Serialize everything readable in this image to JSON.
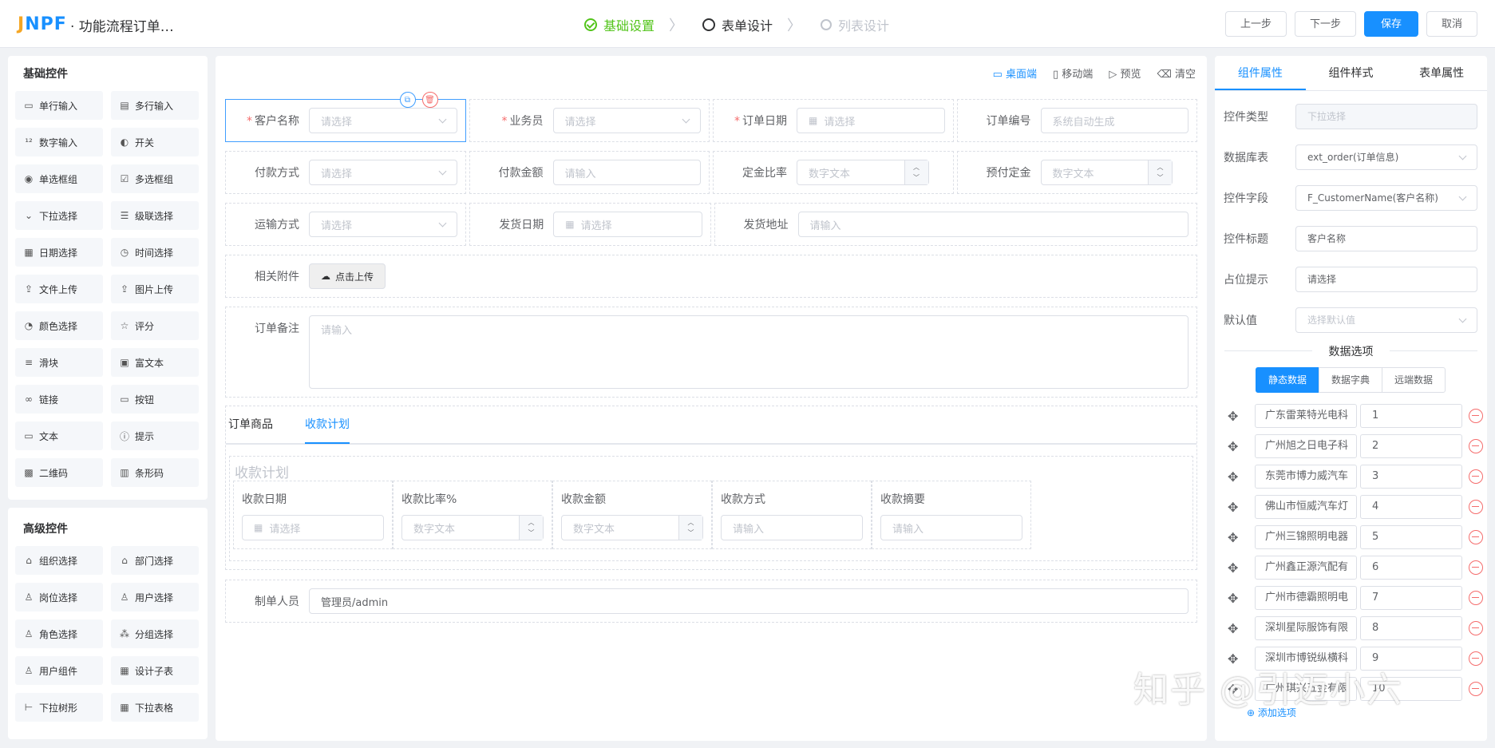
{
  "app": {
    "logo": "JNPF",
    "title": "· 功能流程订单…"
  },
  "steps": [
    {
      "label": "基础设置",
      "state": "done"
    },
    {
      "label": "表单设计",
      "state": "active"
    },
    {
      "label": "列表设计",
      "state": "todo"
    }
  ],
  "top_buttons": {
    "prev": "上一步",
    "next": "下一步",
    "save": "保存",
    "cancel": "取消"
  },
  "basic": {
    "title": "基础控件",
    "items": [
      {
        "label": "单行输入",
        "icon": "input-icon"
      },
      {
        "label": "多行输入",
        "icon": "textarea-icon"
      },
      {
        "label": "数字输入",
        "icon": "number-icon"
      },
      {
        "label": "开关",
        "icon": "switch-icon"
      },
      {
        "label": "单选框组",
        "icon": "radio-icon"
      },
      {
        "label": "多选框组",
        "icon": "checkbox-icon"
      },
      {
        "label": "下拉选择",
        "icon": "select-icon"
      },
      {
        "label": "级联选择",
        "icon": "cascader-icon"
      },
      {
        "label": "日期选择",
        "icon": "calendar-icon"
      },
      {
        "label": "时间选择",
        "icon": "clock-icon"
      },
      {
        "label": "文件上传",
        "icon": "upload-icon"
      },
      {
        "label": "图片上传",
        "icon": "image-upload-icon"
      },
      {
        "label": "颜色选择",
        "icon": "palette-icon"
      },
      {
        "label": "评分",
        "icon": "star-icon"
      },
      {
        "label": "滑块",
        "icon": "slider-icon"
      },
      {
        "label": "富文本",
        "icon": "richtext-icon"
      },
      {
        "label": "链接",
        "icon": "link-icon"
      },
      {
        "label": "按钮",
        "icon": "button-icon"
      },
      {
        "label": "文本",
        "icon": "text-icon"
      },
      {
        "label": "提示",
        "icon": "info-icon"
      },
      {
        "label": "二维码",
        "icon": "qrcode-icon"
      },
      {
        "label": "条形码",
        "icon": "barcode-icon"
      }
    ]
  },
  "advanced": {
    "title": "高级控件",
    "items": [
      {
        "label": "组织选择",
        "icon": "org-icon"
      },
      {
        "label": "部门选择",
        "icon": "dept-icon"
      },
      {
        "label": "岗位选择",
        "icon": "position-icon"
      },
      {
        "label": "用户选择",
        "icon": "user-icon"
      },
      {
        "label": "角色选择",
        "icon": "role-icon"
      },
      {
        "label": "分组选择",
        "icon": "group-icon"
      },
      {
        "label": "用户组件",
        "icon": "user-comp-icon"
      },
      {
        "label": "设计子表",
        "icon": "table-icon"
      },
      {
        "label": "下拉树形",
        "icon": "tree-icon"
      },
      {
        "label": "下拉表格",
        "icon": "table-select-icon"
      }
    ]
  },
  "canvas_toolbar": {
    "desktop": "桌面端",
    "mobile": "移动端",
    "preview": "预览",
    "clear": "清空"
  },
  "form": {
    "row1": [
      {
        "label": "客户名称",
        "required": true,
        "placeholder": "请选择",
        "type": "select"
      },
      {
        "label": "业务员",
        "required": true,
        "placeholder": "请选择",
        "type": "select"
      },
      {
        "label": "订单日期",
        "required": true,
        "placeholder": "请选择",
        "type": "date"
      },
      {
        "label": "订单编号",
        "required": false,
        "placeholder": "系统自动生成",
        "type": "text"
      }
    ],
    "row2": [
      {
        "label": "付款方式",
        "placeholder": "请选择",
        "type": "select"
      },
      {
        "label": "付款金额",
        "placeholder": "请输入",
        "type": "text"
      },
      {
        "label": "定金比率",
        "placeholder": "数字文本",
        "type": "number"
      },
      {
        "label": "预付定金",
        "placeholder": "数字文本",
        "type": "number"
      }
    ],
    "row3": [
      {
        "label": "运输方式",
        "placeholder": "请选择",
        "type": "select"
      },
      {
        "label": "发货日期",
        "placeholder": "请选择",
        "type": "date"
      },
      {
        "label": "发货地址",
        "placeholder": "请输入",
        "type": "text"
      }
    ],
    "attachment": {
      "label": "相关附件",
      "button": "点击上传"
    },
    "remark": {
      "label": "订单备注",
      "placeholder": "请输入"
    },
    "tabs": [
      "订单商品",
      "收款计划"
    ],
    "sub_title": "收款计划",
    "sub_cols": [
      {
        "label": "收款日期",
        "placeholder": "请选择",
        "type": "date"
      },
      {
        "label": "收款比率%",
        "placeholder": "数字文本",
        "type": "number"
      },
      {
        "label": "收款金额",
        "placeholder": "数字文本",
        "type": "number"
      },
      {
        "label": "收款方式",
        "placeholder": "请输入",
        "type": "text"
      },
      {
        "label": "收款摘要",
        "placeholder": "请输入",
        "type": "text"
      }
    ],
    "creator": {
      "label": "制单人员",
      "value": "管理员/admin"
    }
  },
  "props": {
    "tabs": [
      "组件属性",
      "组件样式",
      "表单属性"
    ],
    "rows": [
      {
        "label": "控件类型",
        "value": "下拉选择",
        "kind": "disabled"
      },
      {
        "label": "数据库表",
        "value": "ext_order(订单信息)",
        "kind": "select"
      },
      {
        "label": "控件字段",
        "value": "F_CustomerName(客户名称)",
        "kind": "select"
      },
      {
        "label": "控件标题",
        "value": "客户名称",
        "kind": "text"
      },
      {
        "label": "占位提示",
        "value": "请选择",
        "kind": "text"
      },
      {
        "label": "默认值",
        "value": "选择默认值",
        "kind": "placeholder"
      }
    ],
    "options_title": "数据选项",
    "source_tabs": [
      "静态数据",
      "数据字典",
      "远端数据"
    ],
    "options": [
      {
        "label": "广东雷莱特光电科",
        "value": "1"
      },
      {
        "label": "广州旭之日电子科",
        "value": "2"
      },
      {
        "label": "东莞市博力威汽车",
        "value": "3"
      },
      {
        "label": "佛山市恒威汽车灯",
        "value": "4"
      },
      {
        "label": "广州三锦照明电器",
        "value": "5"
      },
      {
        "label": "广州鑫正源汽配有",
        "value": "6"
      },
      {
        "label": "广州市德霸照明电",
        "value": "7"
      },
      {
        "label": "深圳星际服饰有限",
        "value": "8"
      },
      {
        "label": "深圳市博锐纵横科",
        "value": "9"
      },
      {
        "label": "广州琪兴五金有限",
        "value": "10"
      }
    ],
    "add_option": "添加选项"
  },
  "watermark": "知乎 @引迈小六"
}
